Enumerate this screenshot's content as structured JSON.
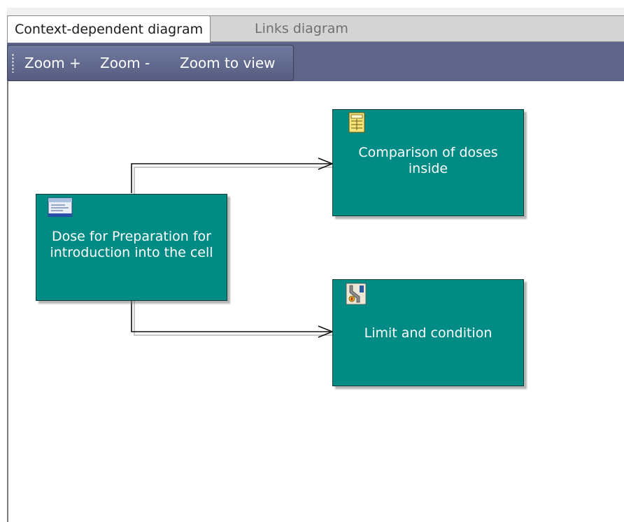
{
  "tabs": [
    {
      "label": "Context-dependent diagram",
      "active": true
    },
    {
      "label": "Links diagram",
      "active": false
    }
  ],
  "toolbar": {
    "zoom_in": "Zoom +",
    "zoom_out": "Zoom -",
    "zoom_to_view": "Zoom to view"
  },
  "diagram": {
    "nodes": [
      {
        "label": "Dose for Preparation for introduction into the cell",
        "icon": "dose-form-icon"
      },
      {
        "label": "Comparison of doses inside",
        "icon": "table-calc-icon"
      },
      {
        "label": "Limit and condition",
        "icon": "limit-condition-icon"
      }
    ],
    "links": [
      {
        "from": "Dose for Preparation for introduction into the cell",
        "to": "Comparison of doses inside"
      },
      {
        "from": "Dose for Preparation for introduction into the cell",
        "to": "Limit and condition"
      }
    ]
  },
  "colors": {
    "node_fill": "#008b85",
    "toolbar": "#5e6588",
    "node_text": "#ffffff"
  }
}
